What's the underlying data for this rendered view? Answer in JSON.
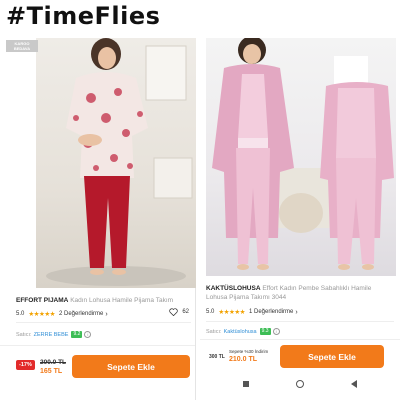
{
  "hashtag": "#TimeFlies",
  "left_product": {
    "badge": "KARGO BEDAVA",
    "brand": "EFFORT PIJAMA",
    "title": "Kadın  Lohusa Hamile Pijama Takım",
    "rating": "5.0",
    "stars": "★★★★★",
    "reviews": "2 Değerlendirme",
    "favorites": "62",
    "seller_label": "Satıcı:",
    "seller_name": "ZERRE BEBE",
    "seller_score": "9.2",
    "discount": "-17%",
    "old_price": "200.0 TL",
    "new_price": "165 TL",
    "cart_button": "Sepete Ekle"
  },
  "right_product": {
    "brand": "KAKTÜSLOHUSA",
    "title": "Effort Kadın Pembe Sabahlıklı Hamile Lohusa Pijama Takımı 3044",
    "rating": "5.0",
    "stars": "★★★★★",
    "reviews": "1 Değerlendirme",
    "seller_label": "Satıcı:",
    "seller_name": "Kaktüslohusa",
    "seller_score": "9.3",
    "old_price": "300 TL",
    "campaign": "Sepete %30 İndirim",
    "price": "210.0 TL",
    "cart_button": "Sepete Ekle"
  },
  "colors": {
    "accent": "#f27a1a",
    "discount": "#e22b2b",
    "score": "#3dbd55",
    "seller_link": "#2f8ed6",
    "stars": "#f2a200"
  },
  "icons": [
    "heart-icon",
    "info-icon",
    "chevron-right-icon",
    "nav-recents-icon",
    "nav-home-icon",
    "nav-back-icon"
  ]
}
